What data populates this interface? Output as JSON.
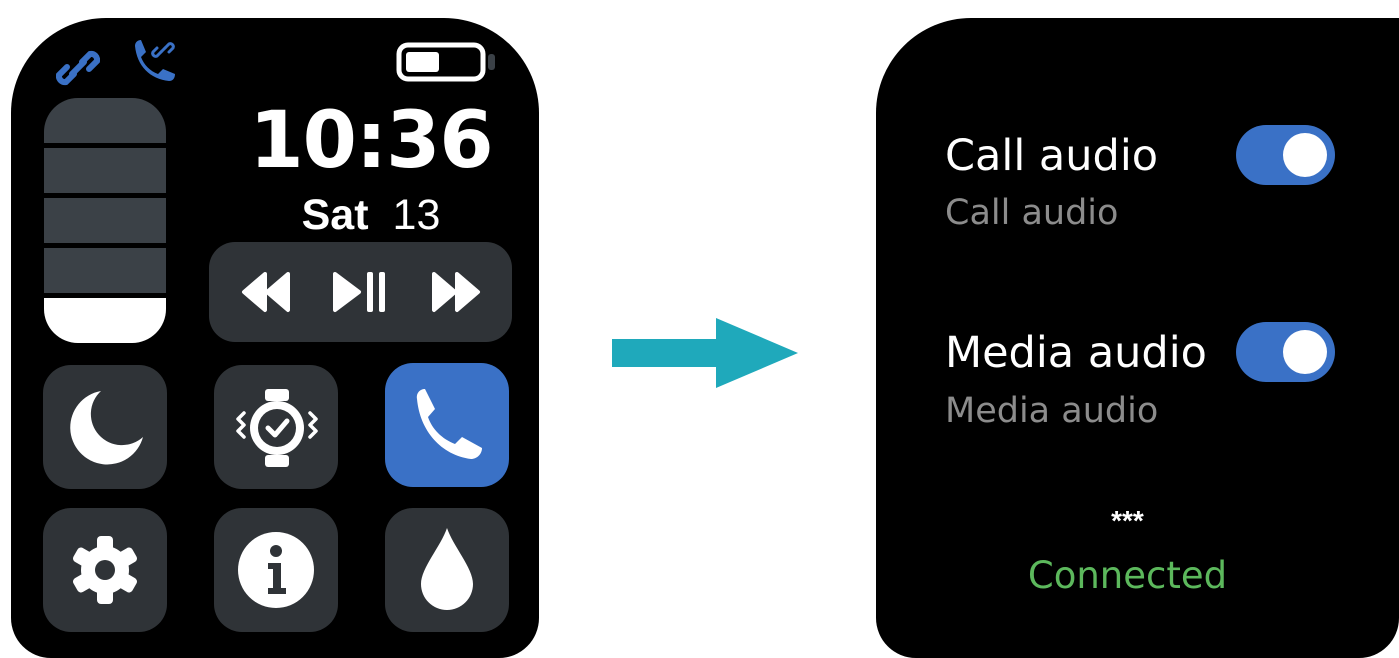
{
  "left_screen": {
    "status_bar": {
      "link_icon": "bluetooth-link-icon",
      "call_icon": "phone-link-icon",
      "battery_icon": "battery-icon",
      "battery_level": 0.45,
      "accent_color": "#3a71c6"
    },
    "brightness_level": 0.2,
    "time": "10:36",
    "date": {
      "day": "Sat",
      "number": "13"
    },
    "media_controls": [
      "rewind-icon",
      "play-pause-icon",
      "fast-forward-icon"
    ],
    "tiles": [
      {
        "icon": "moon-icon",
        "active": false
      },
      {
        "icon": "watch-vibrate-icon",
        "active": false
      },
      {
        "icon": "phone-icon",
        "active": true
      },
      {
        "icon": "gear-icon",
        "active": false
      },
      {
        "icon": "info-icon",
        "active": false
      },
      {
        "icon": "water-drop-icon",
        "active": false
      }
    ]
  },
  "arrow": {
    "icon": "arrow-right-icon",
    "color": "#1fa9bb"
  },
  "right_screen": {
    "options": [
      {
        "title": "Call audio",
        "subtitle": "Call audio",
        "enabled": true
      },
      {
        "title": "Media audio",
        "subtitle": "Media audio",
        "enabled": true
      }
    ],
    "device_name": "***",
    "connection_status": "Connected",
    "status_color": "#5cb85c"
  }
}
